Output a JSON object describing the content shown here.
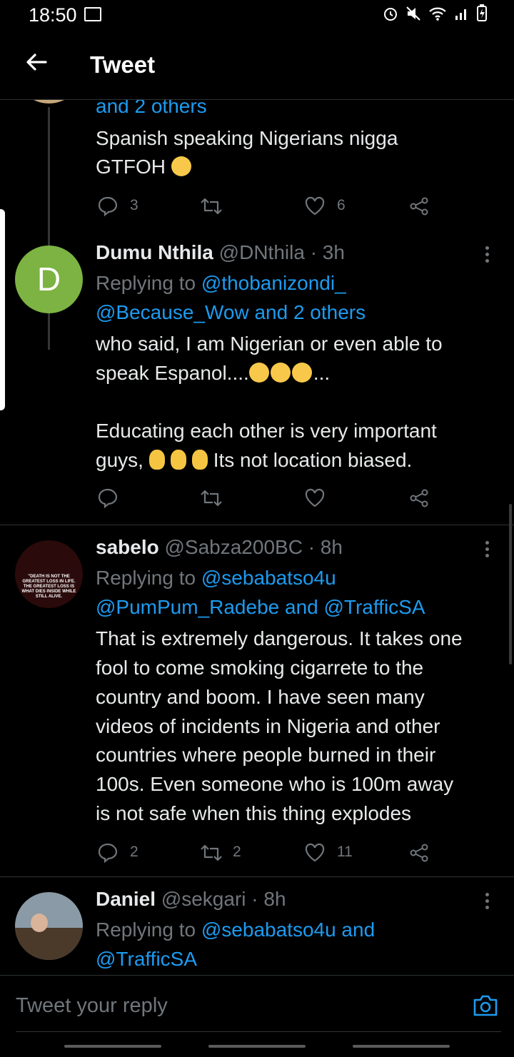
{
  "status_bar": {
    "time": "18:50",
    "icons": [
      "gallery-icon",
      "alarm-icon",
      "mute-icon",
      "wifi-icon",
      "signal-icon",
      "battery-icon"
    ]
  },
  "header": {
    "title": "Tweet",
    "back_icon": "arrow-left-icon"
  },
  "tweets": [
    {
      "reply_tail": "and 2 others",
      "text_lines": [
        "Spanish speaking Nigerians nigga",
        "GTFOH"
      ],
      "counts": {
        "reply": "3",
        "retweet": "",
        "like": "6"
      }
    },
    {
      "name": "Dumu Nthila",
      "handle": "@DNthila",
      "time": "· 3h",
      "avatar_letter": "D",
      "avatar_color": "#7cb342",
      "replying_prefix": "Replying to",
      "replying_1": "@thobanizondi_",
      "replying_2": "@Because_Wow and 2 others",
      "text_lines": [
        "who said, I am Nigerian or even able to",
        "speak Espanol....",
        "...",
        "Educating each other is very important",
        "guys,",
        "Its not location biased."
      ],
      "counts": {
        "reply": "",
        "retweet": "",
        "like": ""
      }
    },
    {
      "name": "sabelo",
      "handle": "@Sabza200BC",
      "time": "· 8h",
      "replying_prefix": "Replying to",
      "replying_1": "@sebabatso4u",
      "replying_2": "@PumPum_Radebe and @TrafficSA",
      "avatar_text": [
        "\"DEATH IS NOT THE",
        "GREATEST LOSS IN LIFE.",
        "THE GREATEST LOSS IS",
        "WHAT DIES INSIDE WHILE",
        "STILL ALIVE."
      ],
      "text_lines": [
        "That is extremely dangerous. It takes one",
        "fool to come smoking cigarrete to the",
        "country and boom. I have seen many",
        "videos of incidents in Nigeria and other",
        "countries where people burned in their",
        "100s. Even someone who is 100m away",
        "is not safe when this thing explodes"
      ],
      "counts": {
        "reply": "2",
        "retweet": "2",
        "like": "11"
      }
    },
    {
      "name": "Daniel",
      "handle": "@sekgari",
      "time": "· 8h",
      "replying_prefix": "Replying to",
      "replying_1": "@sebabatso4u and",
      "replying_2": "@TrafficSA"
    }
  ],
  "reply_box": {
    "placeholder": "Tweet your reply",
    "camera_icon": "camera-icon"
  },
  "colors": {
    "link": "#1d9bf0",
    "muted": "#71767b",
    "background": "#000000"
  }
}
